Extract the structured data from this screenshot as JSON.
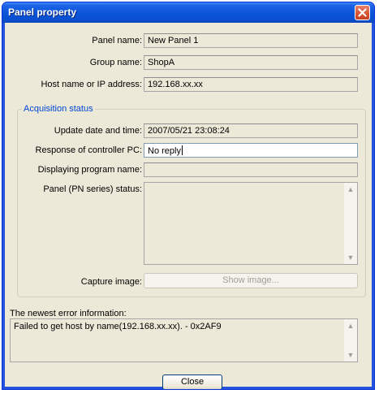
{
  "window": {
    "title": "Panel property"
  },
  "fields": {
    "panel_name": {
      "label": "Panel name:",
      "value": "New Panel 1"
    },
    "group_name": {
      "label": "Group name:",
      "value": "ShopA"
    },
    "host": {
      "label": "Host name or IP address:",
      "value": "192.168.xx.xx"
    }
  },
  "acquisition": {
    "title": "Acquisition status",
    "update": {
      "label": "Update date and time:",
      "value": "2007/05/21 23:08:24"
    },
    "response": {
      "label": "Response of controller PC:",
      "value": "No reply"
    },
    "program": {
      "label": "Displaying program name:",
      "value": ""
    },
    "panel_status": {
      "label": "Panel (PN series) status:",
      "value": ""
    },
    "capture": {
      "label": "Capture image:",
      "button": "Show image..."
    }
  },
  "error": {
    "label": "The newest error information:",
    "value": "Failed to get host by name(192.168.xx.xx). - 0x2AF9"
  },
  "footer": {
    "close_label": "Close"
  },
  "colors": {
    "titlebar": "#0a55d9",
    "face": "#ece9d8",
    "group_title": "#0046d5",
    "close_button": "#d6532f"
  }
}
